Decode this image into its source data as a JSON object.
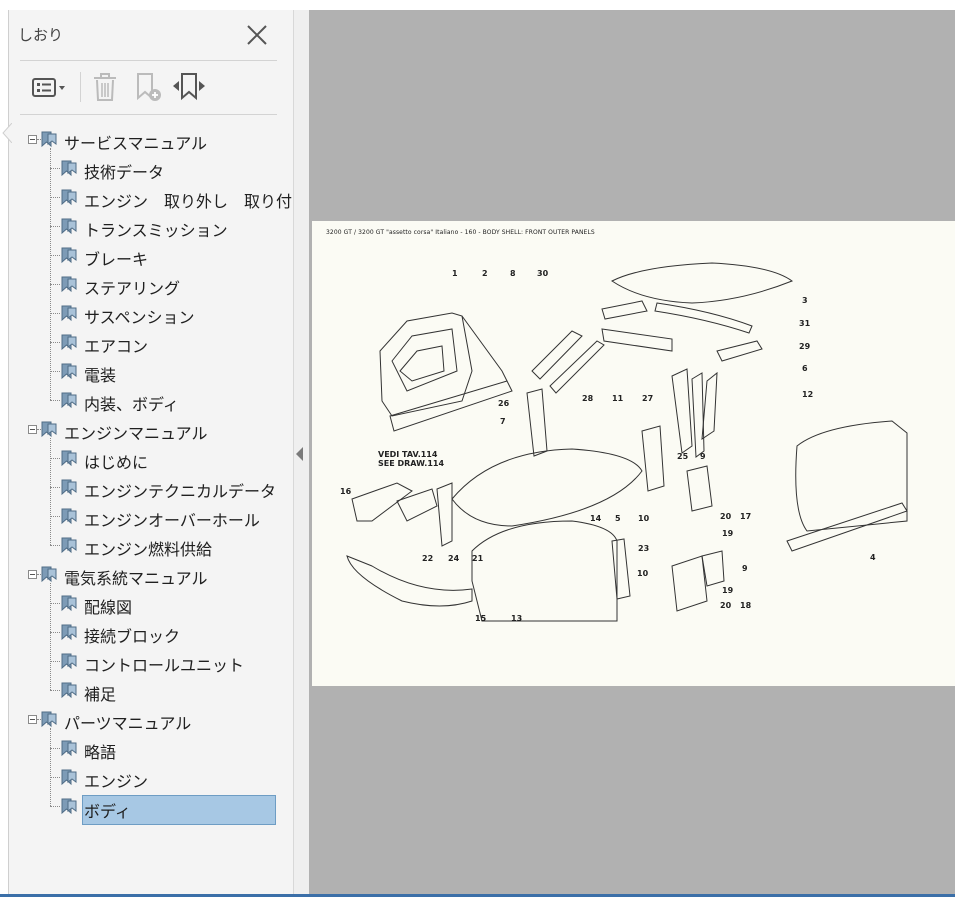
{
  "panel": {
    "title": "しおり",
    "toolbar": {
      "options_icon": "options-list-icon",
      "delete_icon": "trash-icon",
      "new_bookmark_icon": "add-bookmark-icon",
      "expand_icon": "expand-bookmark-icon"
    }
  },
  "bookmarks": [
    {
      "label": "サービスマニュアル",
      "level": 0
    },
    {
      "label": "技術データ",
      "level": 1
    },
    {
      "label": "エンジン　取り外し　取り付け",
      "level": 1
    },
    {
      "label": "トランスミッション",
      "level": 1
    },
    {
      "label": "ブレーキ",
      "level": 1
    },
    {
      "label": "ステアリング",
      "level": 1
    },
    {
      "label": "サスペンション",
      "level": 1
    },
    {
      "label": "エアコン",
      "level": 1
    },
    {
      "label": "電装",
      "level": 1
    },
    {
      "label": "内装、ボディ",
      "level": 1
    },
    {
      "label": "エンジンマニュアル",
      "level": 0
    },
    {
      "label": "はじめに",
      "level": 1
    },
    {
      "label": "エンジンテクニカルデータ",
      "level": 1
    },
    {
      "label": "エンジンオーバーホール",
      "level": 1
    },
    {
      "label": "エンジン燃料供給",
      "level": 1
    },
    {
      "label": "電気系統マニュアル",
      "level": 0
    },
    {
      "label": "配線図",
      "level": 1
    },
    {
      "label": "接続ブロック",
      "level": 1
    },
    {
      "label": "コントロールユニット",
      "level": 1
    },
    {
      "label": "補足",
      "level": 1
    },
    {
      "label": "パーツマニュアル",
      "level": 0
    },
    {
      "label": "略語",
      "level": 1
    },
    {
      "label": "エンジン",
      "level": 1
    },
    {
      "label": "ボディ",
      "level": 1,
      "selected": true
    }
  ],
  "document": {
    "header": "3200 GT / 3200 GT \"assetto corsa\" Italiano - 160 - BODY SHELL: FRONT OUTER PANELS",
    "ref_note": [
      "VEDI TAV.114",
      "SEE DRAW.114"
    ],
    "callouts": [
      "1",
      "2",
      "8",
      "30",
      "3",
      "31",
      "29",
      "6",
      "12",
      "26",
      "28",
      "11",
      "27",
      "7",
      "25",
      "9",
      "16",
      "14",
      "5",
      "10",
      "20",
      "17",
      "19",
      "22",
      "24",
      "21",
      "23",
      "9",
      "10",
      "19",
      "20",
      "18",
      "15",
      "13",
      "4"
    ]
  },
  "colors": {
    "selection": "#a7c8e4",
    "viewer_bg": "#b1b1b1",
    "panel_bg": "#f4f4f4"
  }
}
